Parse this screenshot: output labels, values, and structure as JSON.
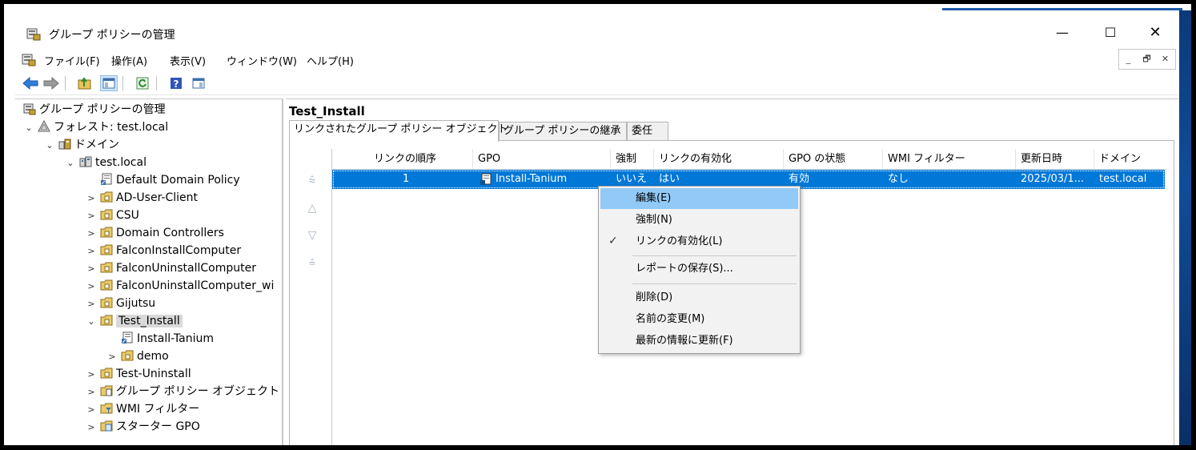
{
  "window": {
    "title": "グループ ポリシーの管理",
    "controls": {
      "minimize": "—",
      "maximize": "☐",
      "close": "✕"
    }
  },
  "menu": {
    "items": [
      "ファイル(F)",
      "操作(A)",
      "表示(V)",
      "ウィンドウ(W)",
      "ヘルプ(H)"
    ],
    "mdi": [
      "_",
      "🗗",
      "✕"
    ]
  },
  "tree": {
    "items": [
      {
        "label": "グループ ポリシーの管理",
        "chev": "",
        "icon": "gpm-icon"
      },
      {
        "label": "フォレスト: test.local",
        "chev": "⌄",
        "icon": "forest-icon"
      },
      {
        "label": "ドメイン",
        "chev": "⌄",
        "icon": "domains-icon"
      },
      {
        "label": "test.local",
        "chev": "⌄",
        "icon": "domain-icon"
      },
      {
        "label": "Default Domain Policy",
        "chev": "",
        "icon": "gpo-link-icon"
      },
      {
        "label": "AD-User-Client",
        "chev": ">",
        "icon": "ou-icon"
      },
      {
        "label": "CSU",
        "chev": ">",
        "icon": "ou-icon"
      },
      {
        "label": "Domain Controllers",
        "chev": ">",
        "icon": "ou-icon"
      },
      {
        "label": "FalconInstallComputer",
        "chev": ">",
        "icon": "ou-icon"
      },
      {
        "label": "FalconUninstallComputer",
        "chev": ">",
        "icon": "ou-icon"
      },
      {
        "label": "FalconUninstallComputer_wi",
        "chev": ">",
        "icon": "ou-icon"
      },
      {
        "label": "Gijutsu",
        "chev": ">",
        "icon": "ou-icon"
      },
      {
        "label": "Test_Install",
        "chev": "⌄",
        "icon": "ou-icon"
      },
      {
        "label": "Install-Tanium",
        "chev": "",
        "icon": "gpo-link-icon"
      },
      {
        "label": "demo",
        "chev": ">",
        "icon": "ou-icon"
      },
      {
        "label": "Test-Uninstall",
        "chev": ">",
        "icon": "ou-icon"
      },
      {
        "label": "グループ ポリシー オブジェクト",
        "chev": ">",
        "icon": "gpo-folder-icon"
      },
      {
        "label": "WMI フィルター",
        "chev": ">",
        "icon": "wmi-folder-icon"
      },
      {
        "label": "スターター GPO",
        "chev": ">",
        "icon": "starter-folder-icon"
      }
    ]
  },
  "main": {
    "title": "Test_Install",
    "tabs": [
      "リンクされたグループ ポリシー オブジェクト",
      "グループ ポリシーの継承",
      "委任"
    ],
    "arrows": [
      "⩯",
      "△",
      "▽",
      "⩮"
    ],
    "columns": [
      "リンクの順序",
      "GPO",
      "強制",
      "リンクの有効化",
      "GPO の状態",
      "WMI フィルター",
      "更新日時",
      "ドメイン"
    ],
    "row": {
      "order": "1",
      "gpo": "Install-Tanium",
      "enforced": "いいえ",
      "link_enabled": "はい",
      "gpo_status": "有効",
      "wmi_filter": "なし",
      "modified": "2025/03/1...",
      "domain": "test.local"
    }
  },
  "context_menu": {
    "check": "✓",
    "items": [
      "編集(E)",
      "強制(N)",
      "リンクの有効化(L)",
      "レポートの保存(S)...",
      "削除(D)",
      "名前の変更(M)",
      "最新の情報に更新(F)"
    ]
  }
}
